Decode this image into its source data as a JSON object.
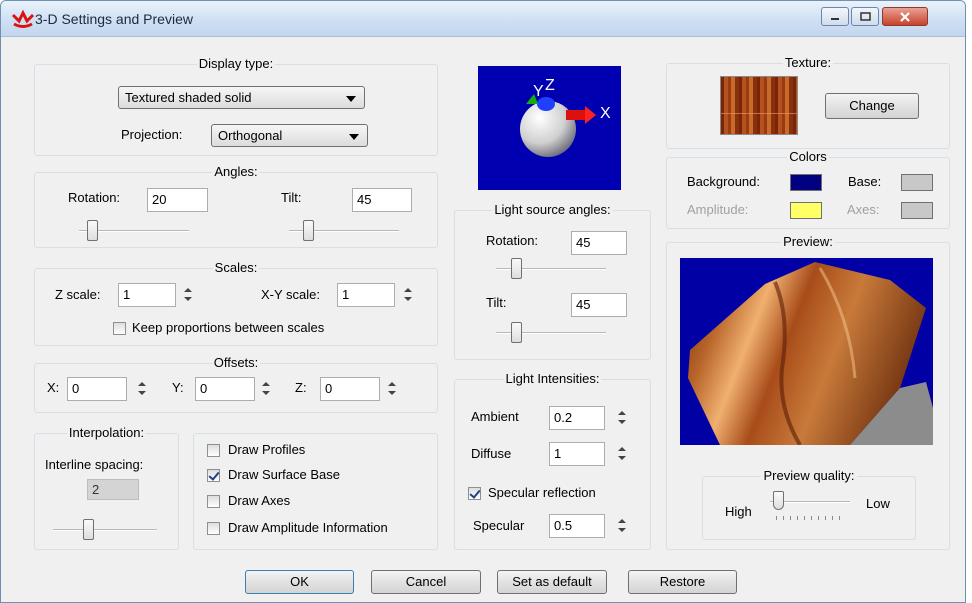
{
  "window": {
    "title": "3-D Settings and Preview",
    "app_icon": "red-logo-icon",
    "controls": [
      "minimize-icon",
      "maximize-icon",
      "close-icon"
    ]
  },
  "display_type": {
    "group_title": "Display type:",
    "value": "Textured shaded solid",
    "projection_label": "Projection:",
    "projection_value": "Orthogonal"
  },
  "angles": {
    "group_title": "Angles:",
    "rotation_label": "Rotation:",
    "rotation_value": "20",
    "tilt_label": "Tilt:",
    "tilt_value": "45"
  },
  "scales": {
    "group_title": "Scales:",
    "z_label": "Z scale:",
    "z_value": "1",
    "xy_label": "X-Y scale:",
    "xy_value": "1",
    "keep_label": "Keep proportions between scales",
    "keep_checked": false
  },
  "offsets": {
    "group_title": "Offsets:",
    "x_label": "X:",
    "x_value": "0",
    "y_label": "Y:",
    "y_value": "0",
    "z_label": "Z:",
    "z_value": "0"
  },
  "interpolation": {
    "group_title": "Interpolation:",
    "spacing_label": "Interline spacing:",
    "spacing_value": "2"
  },
  "draw_options": [
    {
      "label": "Draw Profiles",
      "checked": false
    },
    {
      "label": "Draw Surface Base",
      "checked": true
    },
    {
      "label": "Draw Axes",
      "checked": false
    },
    {
      "label": "Draw Amplitude Information",
      "checked": false
    }
  ],
  "axes_gizmo": {
    "x": "X",
    "y": "Y",
    "z": "Z"
  },
  "light_source": {
    "group_title": "Light source angles:",
    "rotation_label": "Rotation:",
    "rotation_value": "45",
    "tilt_label": "Tilt:",
    "tilt_value": "45"
  },
  "light_intensities": {
    "group_title": "Light Intensities:",
    "ambient_label": "Ambient",
    "ambient_value": "0.2",
    "diffuse_label": "Diffuse",
    "diffuse_value": "1",
    "specular_reflection_label": "Specular reflection",
    "specular_reflection_checked": true,
    "specular_label": "Specular",
    "specular_value": "0.5"
  },
  "texture": {
    "group_title": "Texture:",
    "change_label": "Change"
  },
  "colors": {
    "group_title": "Colors",
    "background_label": "Background:",
    "background_color": "#000080",
    "base_label": "Base:",
    "base_color": "#c8c8c8",
    "amplitude_label": "Amplitude:",
    "amplitude_color": "#ffff66",
    "axes_label": "Axes:",
    "axes_color": "#c8c8c8"
  },
  "preview": {
    "group_title": "Preview:",
    "background_color": "#0000a4"
  },
  "preview_quality": {
    "group_title": "Preview quality:",
    "high_label": "High",
    "low_label": "Low",
    "level": 0
  },
  "buttons": {
    "ok": "OK",
    "cancel": "Cancel",
    "set_default": "Set as default",
    "restore": "Restore"
  }
}
